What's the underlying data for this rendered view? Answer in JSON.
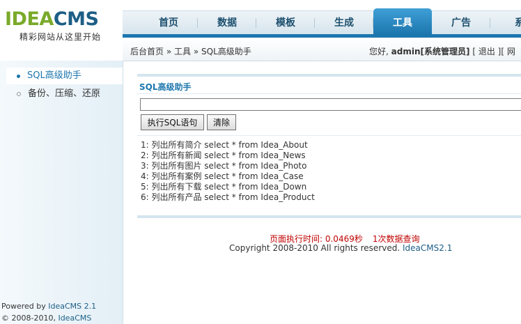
{
  "logo": {
    "part1": "IDEA",
    "part2": "CMS",
    "slogan": "精彩网站从这里开始"
  },
  "nav": {
    "items": [
      {
        "label": "首页"
      },
      {
        "label": "数据"
      },
      {
        "label": "模板"
      },
      {
        "label": "生成"
      },
      {
        "label": "工具"
      },
      {
        "label": "广告"
      },
      {
        "label": "系"
      }
    ],
    "active_index": 4,
    "colors": {
      "active": "#1c76ae",
      "text": "#1d4f6e"
    }
  },
  "breadcrumb": {
    "home": "后台首页",
    "sep": "»",
    "section": "工具",
    "page": "SQL高级助手"
  },
  "user": {
    "greeting": "您好,",
    "name": "admin",
    "role": "[系统管理员]",
    "logout": "[ 退出 ]",
    "more": "[ 网"
  },
  "sidebar": {
    "items": [
      {
        "label": "SQL高级助手"
      },
      {
        "label": "备份、压缩、还原"
      }
    ],
    "active_index": 0,
    "footer": {
      "powered_prefix": "Powered by",
      "powered_link": "IdeaCMS 2.1",
      "copy_prefix": "© 2008-2010,",
      "copy_link": "IdeaCMS"
    }
  },
  "panel": {
    "title": "SQL高级助手",
    "sql_value": "",
    "exec_button": "执行SQL语句",
    "clear_button": "清除",
    "examples": [
      "1: 列出所有简介 select * from Idea_About",
      "2: 列出所有新闻 select * from Idea_News",
      "3: 列出所有图片 select * from Idea_Photo",
      "4: 列出所有案例 select * from Idea_Case",
      "5: 列出所有下载 select * from Idea_Down",
      "6: 列出所有产品 select * from Idea_Product"
    ]
  },
  "footer": {
    "exec_time": "页面执行时间: 0.0469秒",
    "query_count": "1次数据查询",
    "copyright": "Copyright 2008-2010 All rights reserved.",
    "version_link": "IdeaCMS2.1"
  }
}
